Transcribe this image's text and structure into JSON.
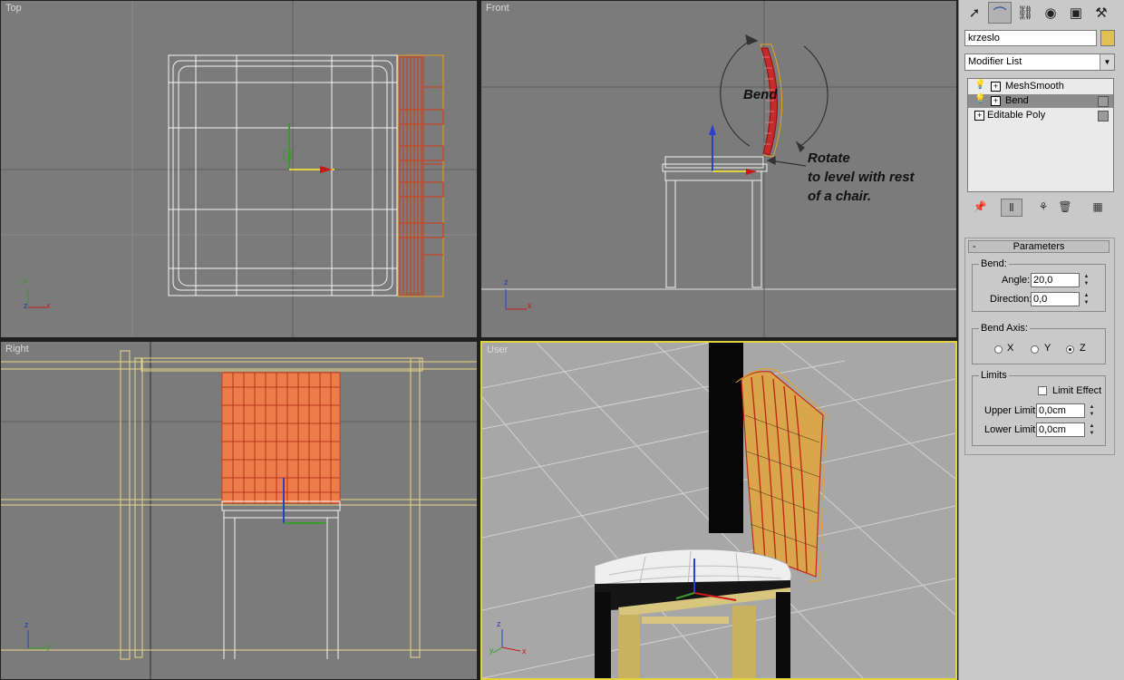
{
  "viewports": {
    "top": {
      "label": "Top"
    },
    "front": {
      "label": "Front"
    },
    "right": {
      "label": "Right"
    },
    "user": {
      "label": "User"
    }
  },
  "annotations": {
    "bend": "Bend",
    "rotate_lines": [
      "Rotate",
      "to level with rest",
      "of a chair."
    ]
  },
  "axis_labels": {
    "x": "x",
    "y": "y",
    "z": "z"
  },
  "command_panel": {
    "tabs": [
      {
        "name": "create",
        "icon": "cursor-icon"
      },
      {
        "name": "modify",
        "icon": "modify-bend-icon"
      },
      {
        "name": "hierarchy",
        "icon": "hierarchy-icon"
      },
      {
        "name": "motion",
        "icon": "motion-icon"
      },
      {
        "name": "display",
        "icon": "display-icon"
      },
      {
        "name": "utilities",
        "icon": "hammer-icon"
      }
    ],
    "object_name": "krzeslo",
    "object_color": "#e0c053",
    "modifier_list": "Modifier List",
    "stack": [
      {
        "label": "MeshSmooth",
        "selected": false
      },
      {
        "label": "Bend",
        "selected": true
      },
      {
        "label": "Editable Poly",
        "selected": false
      }
    ],
    "parameters": {
      "title": "Parameters",
      "collapse": "-",
      "bend_group": "Bend:",
      "angle_label": "Angle:",
      "angle_value": "20,0",
      "direction_label": "Direction:",
      "direction_value": "0,0",
      "bend_axis_group": "Bend Axis:",
      "axis_x": "X",
      "axis_y": "Y",
      "axis_z": "Z",
      "axis_selected": "Z",
      "limits_group": "Limits",
      "limit_effect": "Limit Effect",
      "upper_limit_label": "Upper Limit:",
      "upper_limit_value": "0,0cm",
      "lower_limit_label": "Lower Limit:",
      "lower_limit_value": "0,0cm"
    }
  },
  "colors": {
    "viewport_bg": "#7b7b7b",
    "user_bg": "#a7a7a7",
    "selection": "#d63a16",
    "wire_yellow": "#e8d68a",
    "active_border": "#e2d23e"
  }
}
